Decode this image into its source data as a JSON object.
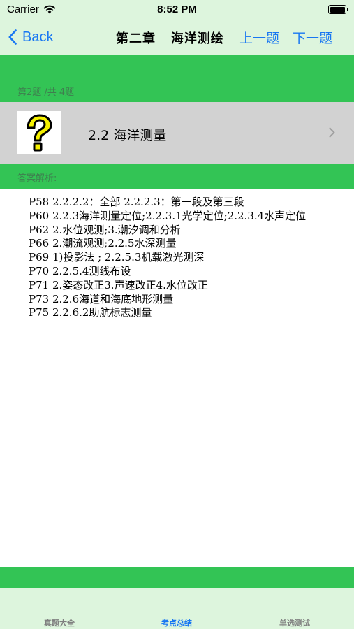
{
  "status_bar": {
    "carrier": "Carrier",
    "time": "8:52 PM"
  },
  "nav": {
    "back_label": "Back",
    "title": "第二章   海洋测绘",
    "prev_label": "上一题",
    "next_label": "下一题"
  },
  "question": {
    "counter": "第2题 /共 4题",
    "title": "2.2 海洋测量",
    "icon": "question-mark-icon"
  },
  "answer": {
    "label": "答案解析:",
    "lines": [
      "P58 2.2.2.2：全部 2.2.2.3：第一段及第三段",
      "P60 2.2.3海洋测量定位;2.2.3.1光学定位;2.2.3.4水声定位",
      "P62 2.水位观测;3.潮汐调和分析",
      "P66 2.潮流观测;2.2.5水深测量",
      "P69 1)投影法 ; 2.2.5.3机载激光测深",
      "P70 2.2.5.4测线布设",
      "P71 2.姿态改正3.声速改正4.水位改正",
      "P73 2.2.6海道和海底地形测量",
      "P75 2.2.6.2助航标志测量"
    ]
  },
  "tabs": [
    {
      "label": "真题大全",
      "active": false
    },
    {
      "label": "考点总结",
      "active": true
    },
    {
      "label": "单选测试",
      "active": false
    }
  ],
  "colors": {
    "accent_blue": "#1877f2",
    "green_band": "#33c455",
    "light_green": "#ddf5dd",
    "row_gray": "#d2d2d2",
    "question_yellow": "#f5f000"
  }
}
